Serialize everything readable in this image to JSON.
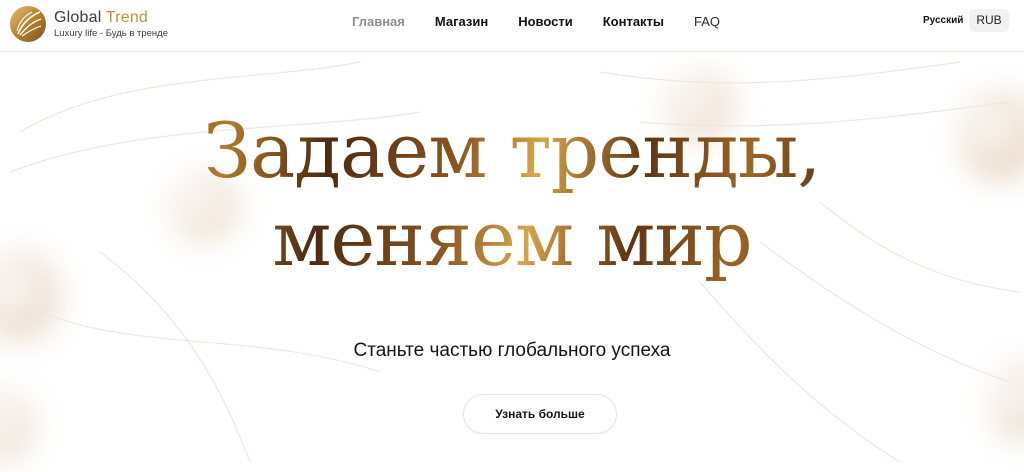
{
  "header": {
    "logo": {
      "title_a": "Global",
      "title_b": "Trend",
      "tagline": "Luxury life - Будь в тренде"
    },
    "nav": [
      {
        "label": "Главная",
        "active": true
      },
      {
        "label": "Магазин",
        "active": false
      },
      {
        "label": "Новости",
        "active": false
      },
      {
        "label": "Контакты",
        "active": false
      },
      {
        "label": "FAQ",
        "active": false
      }
    ],
    "language": "Русский",
    "currency": "RUB"
  },
  "hero": {
    "headline_line1": "Задаем тренды,",
    "headline_line2": "меняем мир",
    "subtitle": "Станьте частью глобального успеха",
    "cta_label": "Узнать больше"
  },
  "colors": {
    "accent_gold": "#c1903f",
    "text_dark": "#111111",
    "nav_active": "#8e8e8e"
  },
  "icons": [
    "logo-leaf-icon"
  ]
}
